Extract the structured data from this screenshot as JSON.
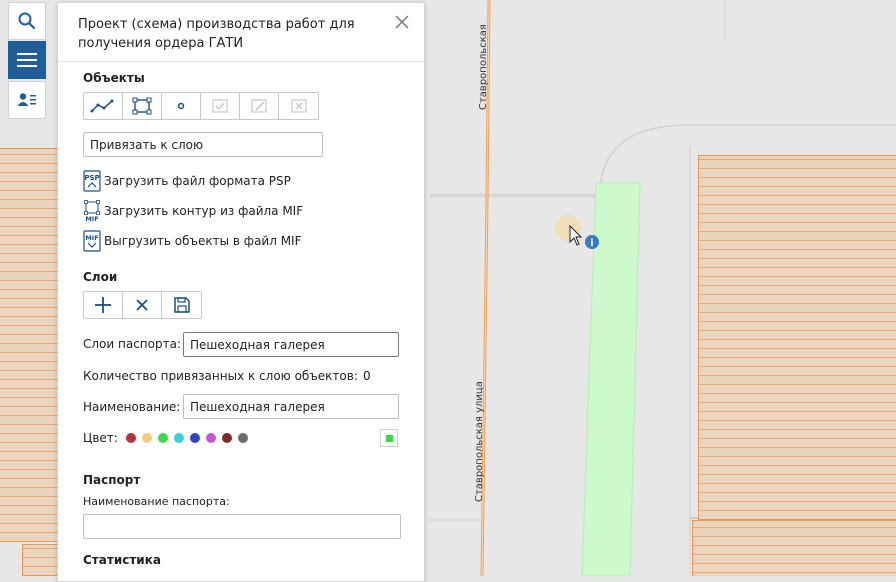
{
  "map": {
    "street_top": "Ставропольская",
    "street_bottom": "Ставропольская улица"
  },
  "toolbar": {
    "search_icon": "search-icon",
    "menu_icon": "hamburger-menu-icon",
    "user_icon": "user-list-icon"
  },
  "panel": {
    "title": "Проект (схема) производства работ для получения ордера ГАТИ",
    "objects": {
      "heading": "Объекты",
      "tools": [
        "polyline-icon",
        "rectangle-icon",
        "point-icon",
        "select-objects-icon",
        "edit-objects-icon",
        "delete-objects-icon"
      ],
      "bind_layer": "Привязать к слою",
      "actions": [
        {
          "icon": "PSP",
          "label": "Загрузить файл формата PSP"
        },
        {
          "icon": "MIF",
          "label": "Загрузить контур из файла MIF"
        },
        {
          "icon": "MIF",
          "label": "Выгрузить объекты в файл MIF"
        }
      ]
    },
    "layers": {
      "heading": "Слои",
      "tools": [
        "add-icon",
        "remove-icon",
        "save-icon"
      ],
      "passport_layers_label": "Слои паспорта:",
      "passport_layers_value": "Пешеходная галерея",
      "count_label": "Количество привязанных к слою объектов:",
      "count_value": "0",
      "name_label": "Наименование:",
      "name_value": "Пешеходная галерея",
      "color_label": "Цвет:",
      "colors": [
        "#b5313b",
        "#f2cf7d",
        "#3fd54a",
        "#39d0d6",
        "#3242c0",
        "#c656d2",
        "#7d2a2a",
        "#6d6b6b"
      ],
      "selected_color": "#3fd54a"
    },
    "passport": {
      "heading": "Паспорт",
      "name_label": "Наименование паспорта:",
      "name_value": ""
    },
    "statistics": {
      "heading": "Статистика"
    }
  },
  "colors": {
    "accent": "#1f5f96",
    "parcel_fill": "#e9d4bd",
    "parcel_line": "#eba872",
    "green_zone": "#ccfacc"
  }
}
